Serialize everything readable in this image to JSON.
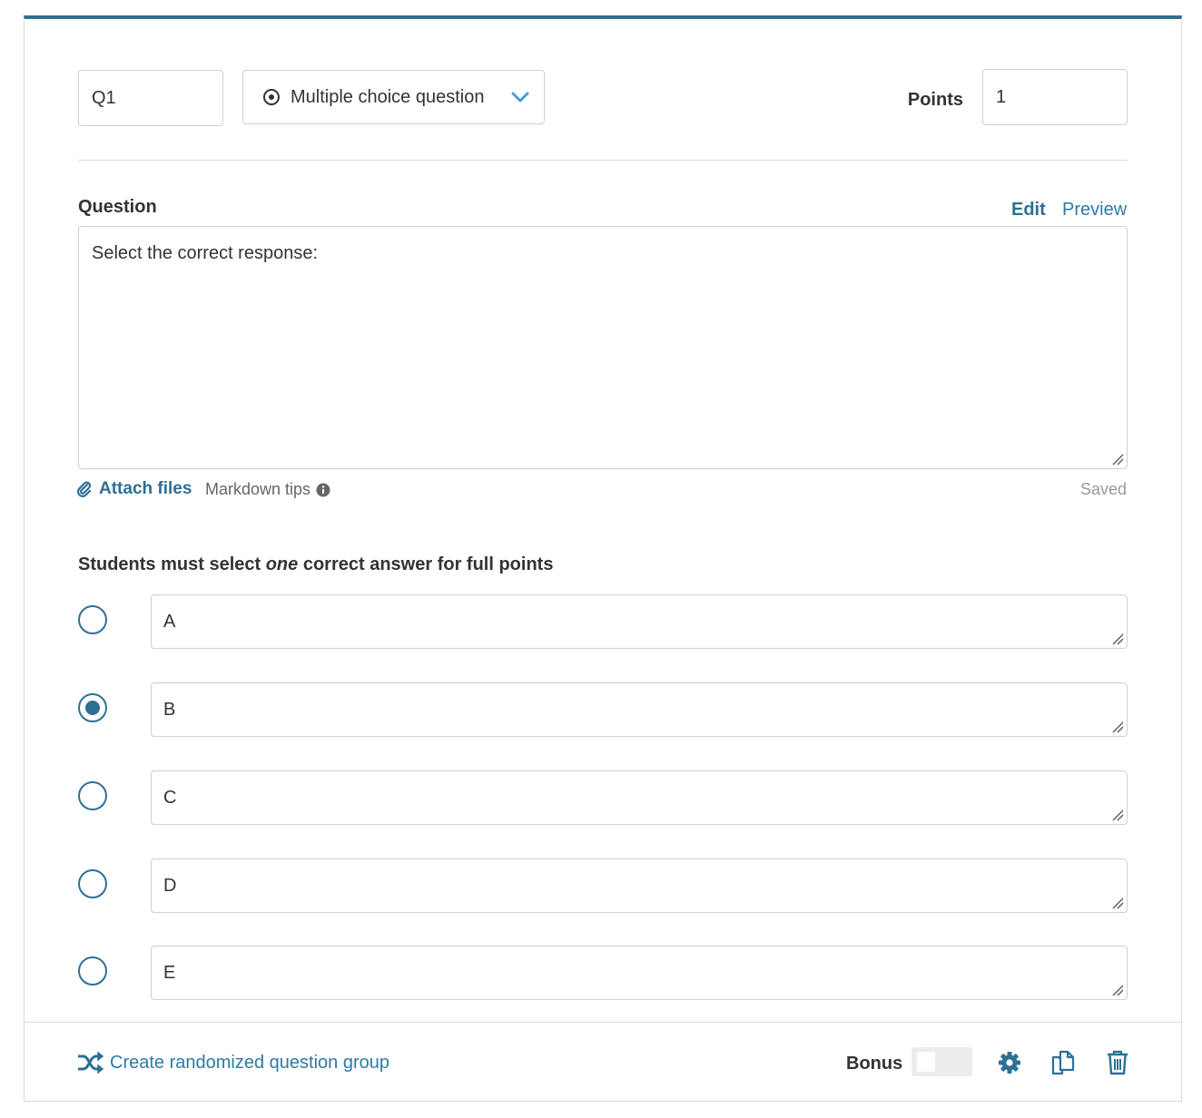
{
  "question_header": {
    "id_value": "Q1",
    "type_select": {
      "selected": "Multiple choice question"
    },
    "points_label": "Points",
    "points_value": "1"
  },
  "question": {
    "label": "Question",
    "tabs": {
      "edit": "Edit",
      "preview": "Preview"
    },
    "body": "Select the correct response:",
    "attach_files": "Attach files",
    "markdown_tips": "Markdown tips",
    "save_status": "Saved"
  },
  "answers": {
    "instruction_pre": "Students must select ",
    "instruction_em": "one",
    "instruction_post": " correct answer for full points",
    "options": [
      {
        "text": "A",
        "correct": false
      },
      {
        "text": "B",
        "correct": true
      },
      {
        "text": "C",
        "correct": false
      },
      {
        "text": "D",
        "correct": false
      },
      {
        "text": "E",
        "correct": false
      }
    ]
  },
  "footer": {
    "randomize_link": "Create randomized question group",
    "bonus_label": "Bonus",
    "bonus_on": false
  },
  "icons": {
    "type": "radio-target-icon",
    "dropdown": "chevron-down-icon",
    "attach": "paperclip-icon",
    "info": "info-circle-icon",
    "randomize": "shuffle-icon",
    "settings": "gear-icon",
    "duplicate": "copy-icon",
    "delete": "trash-icon"
  },
  "colors": {
    "accent": "#2e6f95",
    "link": "#2e7aa5",
    "border": "#cfcfcf",
    "muted": "#9a9a9a"
  }
}
